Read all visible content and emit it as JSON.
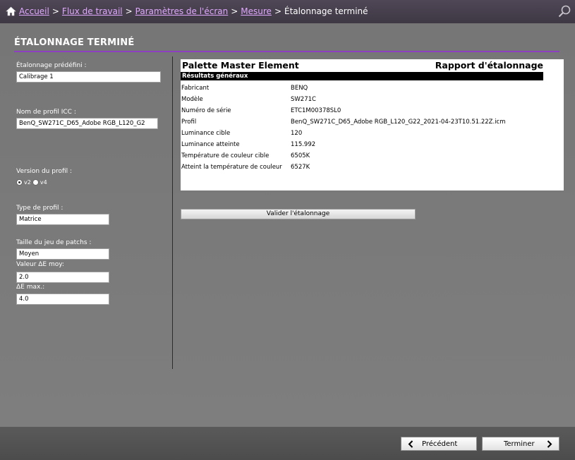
{
  "breadcrumb": {
    "items": [
      "Accueil",
      "Flux de travail",
      "Paramètres de l'écran",
      "Mesure"
    ],
    "current": "Étalonnage terminé",
    "separator": ">"
  },
  "page_title": "ÉTALONNAGE TERMINÉ",
  "left_panel": {
    "preset_label": "Étalonnage prédéfini :",
    "preset_value": "Calibrage 1",
    "icc_label": "Nom de profil ICC  :",
    "icc_value": "BenQ_SW271C_D65_Adobe RGB_L120_G2",
    "version_label": "Version du profil :",
    "version_options": [
      "v2",
      "v4"
    ],
    "version_selected": "v2",
    "profile_type_label": "Type de profil :",
    "profile_type_value": "Matrice",
    "patch_size_label": "Taille du jeu de patchs :",
    "patch_size_value": "Moyen",
    "avg_de_label": "Valeur ΔE moy:",
    "avg_de_value": "2.0",
    "max_de_label": "ΔE max.:",
    "max_de_value": "4.0"
  },
  "report": {
    "app_name": "Palette Master Element",
    "report_title": "Rapport d'étalonnage",
    "section": "Résultats généraux",
    "rows": [
      {
        "key": "Fabricant",
        "value": "BENQ"
      },
      {
        "key": "Modèle",
        "value": "SW271C"
      },
      {
        "key": "Numéro de série",
        "value": "ETC1M00378SL0"
      },
      {
        "key": "Profil",
        "value": "BenQ_SW271C_D65_Adobe RGB_L120_G22_2021-04-23T10.51.22Z.icm"
      },
      {
        "key": "Luminance cible",
        "value": "120"
      },
      {
        "key": "Luminance atteinte",
        "value": "115.992"
      },
      {
        "key": "Température de couleur cible",
        "value": "6505K"
      },
      {
        "key": "Atteint la température de couleur",
        "value": "6527K"
      }
    ]
  },
  "validate_button": "Valider l'étalonnage",
  "footer": {
    "prev_label": "Précédent",
    "finish_label": "Terminer"
  },
  "colors": {
    "accent_line": "#8c3fc0",
    "breadcrumb_link": "#e0a8ff",
    "top_bar": "#463f4c"
  }
}
